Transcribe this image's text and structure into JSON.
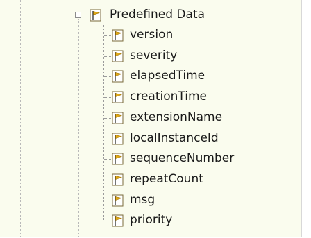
{
  "tree": {
    "parent": {
      "label": "Predefined Data",
      "icon": "tag-flag-icon",
      "expanded": true
    },
    "children": [
      {
        "label": "version"
      },
      {
        "label": "severity"
      },
      {
        "label": "elapsedTime"
      },
      {
        "label": "creationTime"
      },
      {
        "label": "extensionName"
      },
      {
        "label": "localInstanceId"
      },
      {
        "label": "sequenceNumber"
      },
      {
        "label": "repeatCount"
      },
      {
        "label": "msg"
      },
      {
        "label": "priority"
      }
    ]
  },
  "colors": {
    "panel_bg": "#fafcee",
    "tree_guide": "#b9b9b9",
    "icon_flag": "#e0a818",
    "text": "#1a1a1a"
  }
}
